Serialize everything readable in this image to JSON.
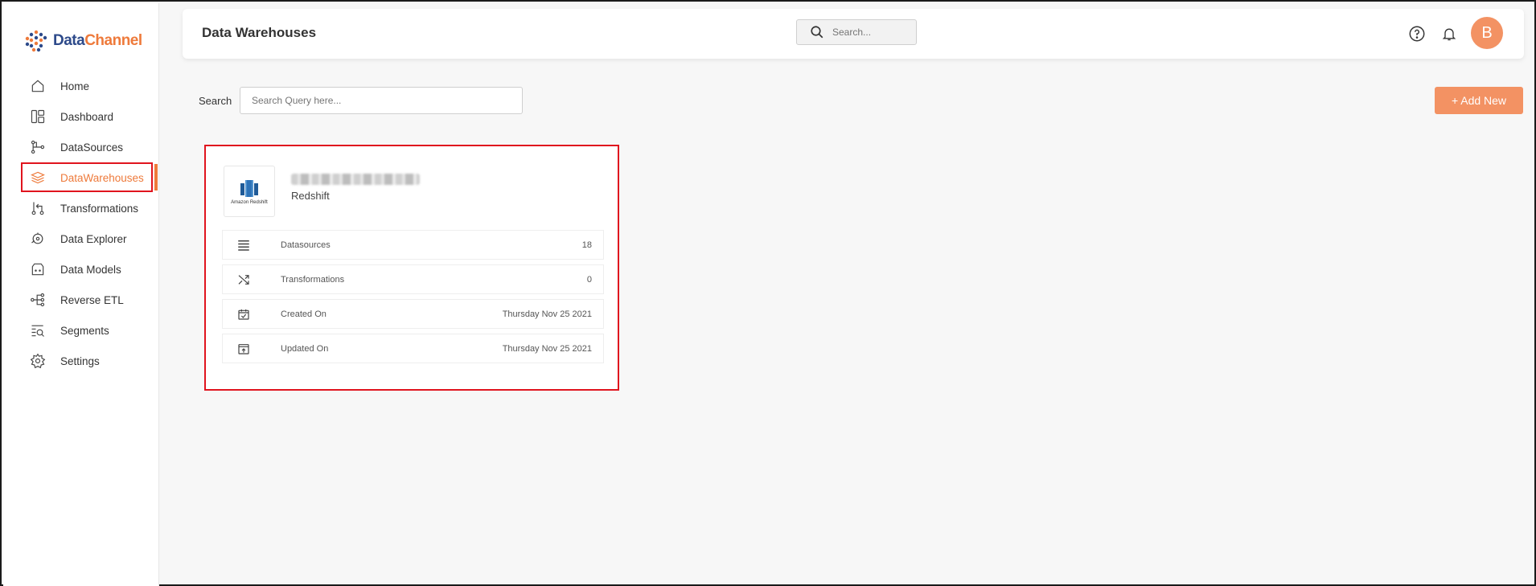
{
  "brand": {
    "name_part1": "Data",
    "name_part2": "Channel"
  },
  "sidebar": {
    "items": [
      {
        "label": "Home",
        "icon": "home-icon"
      },
      {
        "label": "Dashboard",
        "icon": "dashboard-icon"
      },
      {
        "label": "DataSources",
        "icon": "datasources-icon"
      },
      {
        "label": "DataWarehouses",
        "icon": "layers-icon",
        "active": true
      },
      {
        "label": "Transformations",
        "icon": "transformations-icon"
      },
      {
        "label": "Data Explorer",
        "icon": "explorer-icon"
      },
      {
        "label": "Data Models",
        "icon": "models-icon"
      },
      {
        "label": "Reverse ETL",
        "icon": "reverse-etl-icon"
      },
      {
        "label": "Segments",
        "icon": "segments-icon"
      },
      {
        "label": "Settings",
        "icon": "gear-icon"
      }
    ]
  },
  "header": {
    "title": "Data Warehouses",
    "search_placeholder": "Search...",
    "avatar_initial": "B"
  },
  "toolbar": {
    "search_label": "Search",
    "search_placeholder": "Search Query here...",
    "add_label": "+ Add New"
  },
  "card": {
    "logo_caption": "Amazon Redshift",
    "name": "",
    "type": "Redshift",
    "rows": [
      {
        "label": "Datasources",
        "value": "18",
        "icon": "list-icon"
      },
      {
        "label": "Transformations",
        "value": "0",
        "icon": "shuffle-icon"
      },
      {
        "label": "Created On",
        "value": "Thursday Nov 25 2021",
        "icon": "calendar-check-icon"
      },
      {
        "label": "Updated On",
        "value": "Thursday Nov 25 2021",
        "icon": "upload-icon"
      }
    ]
  },
  "colors": {
    "accent": "#f39263",
    "highlight": "#e0141e",
    "brand_blue": "#2d4a8a"
  }
}
